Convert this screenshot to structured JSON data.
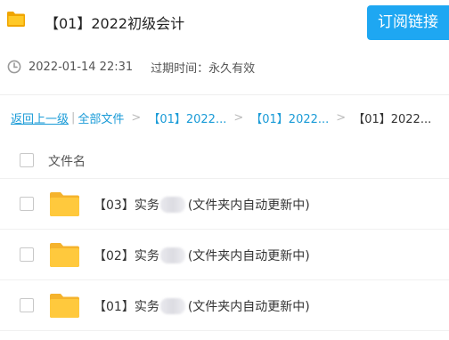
{
  "header": {
    "folder_icon": "folder-icon",
    "title": "【01】2022初级会计",
    "subscribe_label": "订阅链接",
    "accent_color": "#1ea7f2"
  },
  "meta": {
    "clock_icon": "clock-icon",
    "created_at": "2022-01-14 22:31",
    "expire_text": "过期时间：永久有效"
  },
  "breadcrumb": {
    "back": "返回上一级",
    "separator_bar": "|",
    "all_files": "全部文件",
    "crumb1": "【01】2022...",
    "crumb2": "【01】2022...",
    "current": "【01】2022...",
    "separator": ">",
    "link_color": "#1a9bd7"
  },
  "list": {
    "column_name": "文件名",
    "rows": [
      {
        "prefix": "【03】实务",
        "suffix": "(文件夹内自动更新中)"
      },
      {
        "prefix": "【02】实务",
        "suffix": "(文件夹内自动更新中)"
      },
      {
        "prefix": "【01】实务",
        "suffix": "(文件夹内自动更新中)"
      }
    ]
  }
}
